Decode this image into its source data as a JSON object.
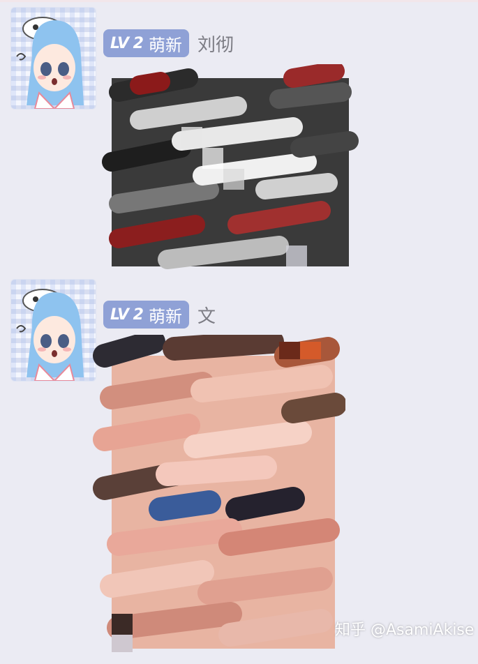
{
  "messages": [
    {
      "level": "LV 2",
      "badge_title": "萌新",
      "sender": "刘彻",
      "image": "mosaic-blurred-photo-1"
    },
    {
      "level": "LV 2",
      "badge_title": "萌新",
      "sender": "文",
      "image": "mosaic-blurred-photo-2"
    }
  ],
  "watermark": "知乎 @AsamiAkise",
  "colors": {
    "background": "#ebebf3",
    "badge": "#8fa1d6",
    "sender_text": "#7c7c84"
  }
}
